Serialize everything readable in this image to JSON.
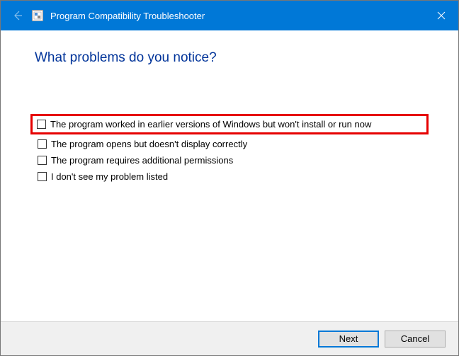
{
  "titlebar": {
    "title": "Program Compatibility Troubleshooter"
  },
  "heading": "What problems do you notice?",
  "options": [
    {
      "label": "The program worked in earlier versions of Windows but won't install or run now",
      "checked": false,
      "highlighted": true
    },
    {
      "label": "The program opens but doesn't display correctly",
      "checked": false,
      "highlighted": false
    },
    {
      "label": "The program requires additional permissions",
      "checked": false,
      "highlighted": false
    },
    {
      "label": "I don't see my problem listed",
      "checked": false,
      "highlighted": false
    }
  ],
  "footer": {
    "next_label": "Next",
    "cancel_label": "Cancel"
  }
}
